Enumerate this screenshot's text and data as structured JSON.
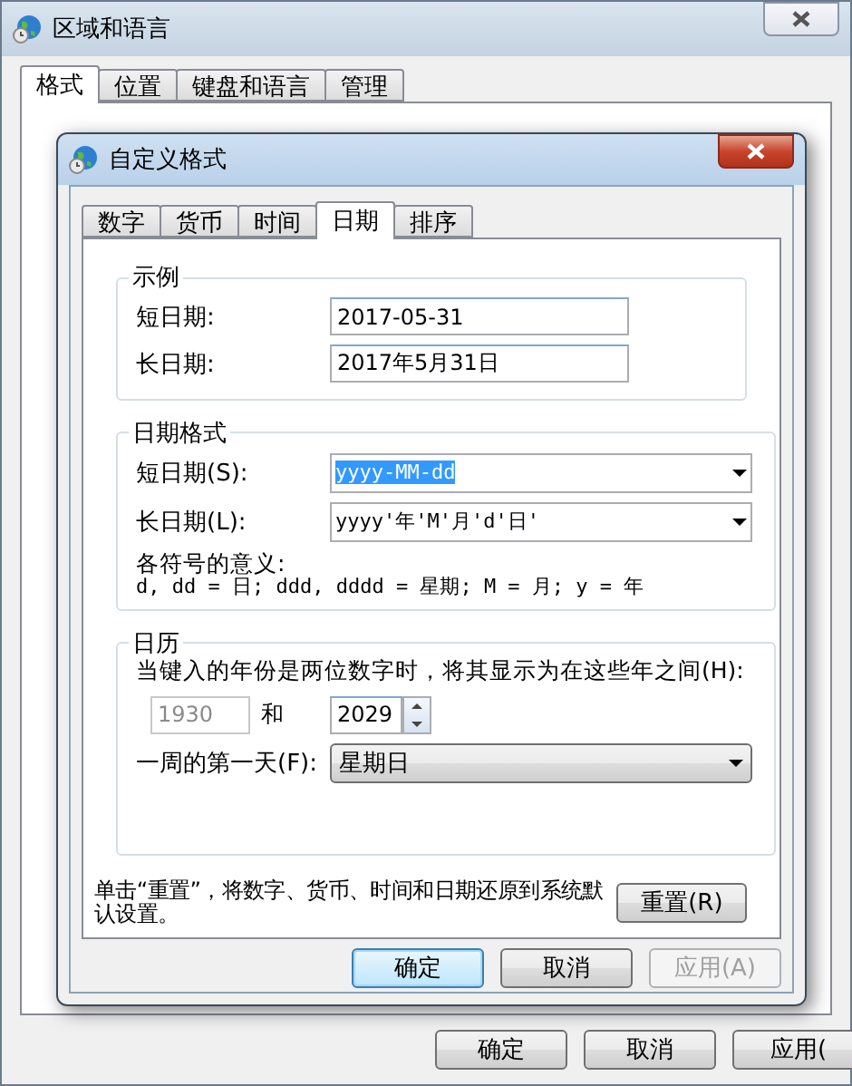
{
  "window": {
    "title": "区域和语言"
  },
  "tabs": [
    {
      "label": "格式",
      "selected": true
    },
    {
      "label": "位置",
      "selected": false
    },
    {
      "label": "键盘和语言",
      "selected": false
    },
    {
      "label": "管理",
      "selected": false
    }
  ],
  "buttons": [
    {
      "label": "确定",
      "disabled": false
    },
    {
      "label": "取消",
      "disabled": false
    },
    {
      "label": "应用(",
      "disabled": false
    }
  ],
  "dialog": {
    "title": "自定义格式",
    "tabs": [
      {
        "label": "数字",
        "selected": false
      },
      {
        "label": "货币",
        "selected": false
      },
      {
        "label": "时间",
        "selected": false
      },
      {
        "label": "日期",
        "selected": true
      },
      {
        "label": "排序",
        "selected": false
      }
    ],
    "example": {
      "title": "示例",
      "rows": [
        {
          "label": "短日期:",
          "value": "2017-05-31"
        },
        {
          "label": "长日期:",
          "value": "2017年5月31日"
        }
      ]
    },
    "date_formats": {
      "title": "日期格式",
      "rows": [
        {
          "label": "短日期(S):",
          "value": "yyyy-MM-dd",
          "selected": true
        },
        {
          "label": "长日期(L):",
          "value": "yyyy'年'M'月'd'日'",
          "selected": false
        }
      ],
      "legend_title": "各符号的意义:",
      "legend": "d, dd = 日;  ddd, dddd = 星期;  M = 月;  y = 年"
    },
    "calendar": {
      "title": "日历",
      "description": "当键入的年份是两位数字时，将其显示为在这些年之间(H):",
      "year_from": {
        "value": "1930",
        "disabled": true
      },
      "and": "和",
      "year_to": {
        "value": "2029",
        "disabled": false
      },
      "first_day_label": "一周的第一天(F):",
      "first_day": "星期日"
    },
    "reset_note": "单击“重置”，将数字、货币、时间和日期还原到系统默认设置。",
    "reset_button": "重置(R)",
    "buttons": [
      {
        "label": "确定",
        "default": true,
        "disabled": false
      },
      {
        "label": "取消",
        "default": false,
        "disabled": false
      },
      {
        "label": "应用(A)",
        "default": false,
        "disabled": true
      }
    ]
  }
}
